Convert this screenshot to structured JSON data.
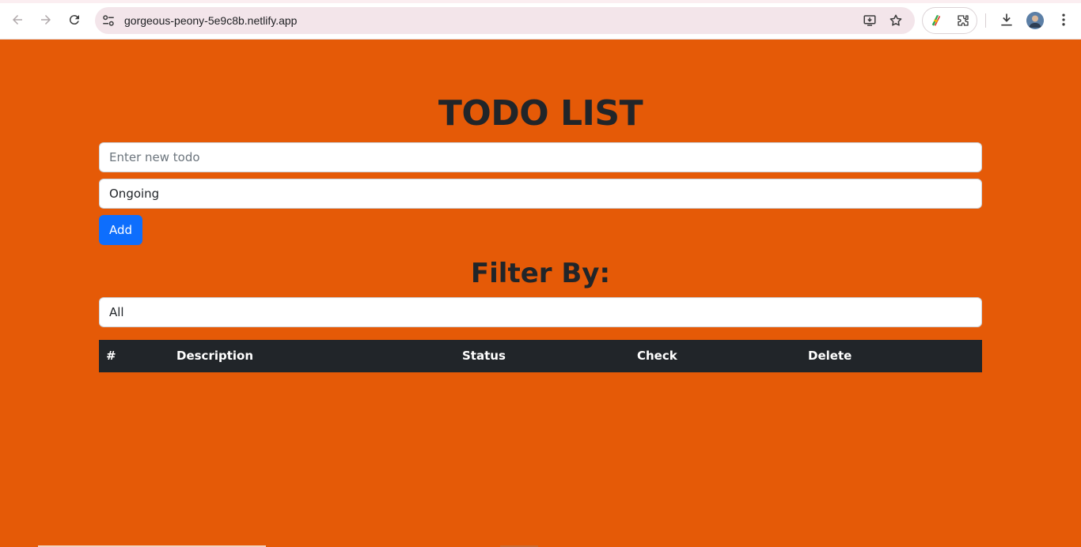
{
  "browser": {
    "url": "gorgeous-peony-5e9c8b.netlify.app",
    "icons": [
      "back-icon",
      "forward-icon",
      "reload-icon",
      "site-settings-icon",
      "install-app-icon",
      "bookmark-star-icon",
      "extension-color-icon",
      "puzzle-extensions-icon",
      "download-icon",
      "profile-avatar",
      "more-menu-icon"
    ]
  },
  "page": {
    "title": "TODO LIST",
    "todo_input": {
      "placeholder": "Enter new todo",
      "value": ""
    },
    "status_select": {
      "value": "Ongoing"
    },
    "add_label": "Add",
    "filter_title": "Filter By:",
    "filter_select": {
      "value": "All"
    },
    "table": {
      "headers": [
        "#",
        "Description",
        "Status",
        "Check",
        "Delete"
      ],
      "rows": []
    }
  },
  "colors": {
    "background": "#e55a07",
    "primary_button": "#0d6efd",
    "table_header": "#212529",
    "title_text": "#212529"
  }
}
